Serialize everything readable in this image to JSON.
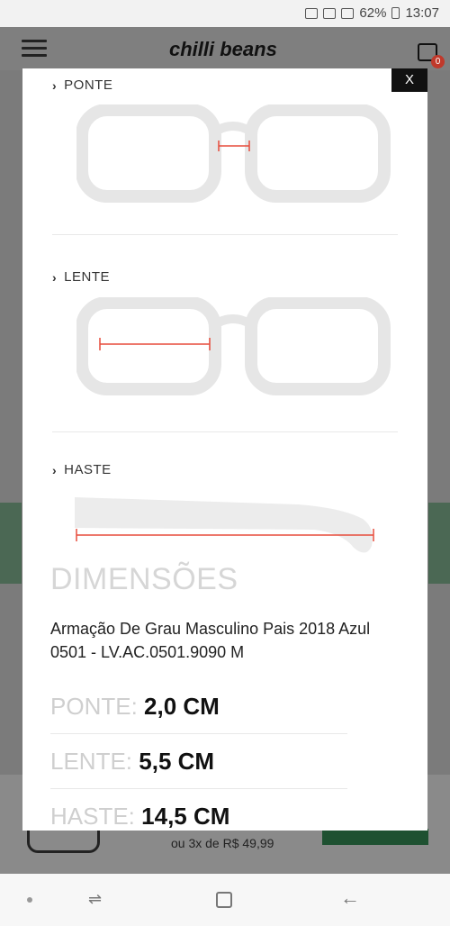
{
  "status": {
    "battery": "62%",
    "time": "13:07"
  },
  "app": {
    "logo": "chilli beans",
    "cart_count": "0"
  },
  "modal": {
    "close_label": "X",
    "sections": [
      {
        "label": "PONTE"
      },
      {
        "label": "LENTE"
      },
      {
        "label": "HASTE"
      }
    ],
    "title": "DIMENSÕES",
    "description": "Armação De Grau Masculino Pais 2018 Azul 0501 - LV.AC.0501.9090 M",
    "dimensions": [
      {
        "key": "PONTE:",
        "value": "2,0 CM"
      },
      {
        "key": "LENTE:",
        "value": "5,5 CM"
      },
      {
        "key": "HASTE:",
        "value": "14,5 CM"
      }
    ]
  },
  "behind": {
    "installments": "ou  3x de R$ 49,99"
  }
}
